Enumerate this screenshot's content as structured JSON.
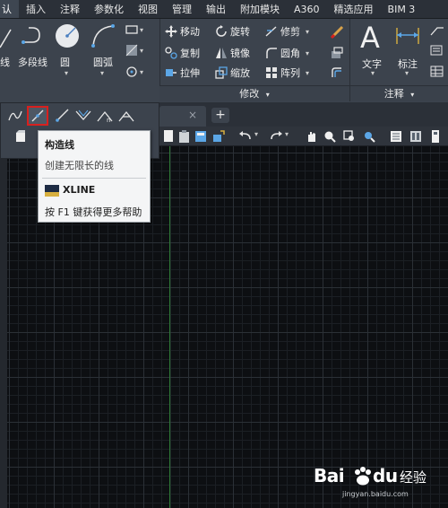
{
  "ribbon_tabs": [
    "认",
    "插入",
    "注释",
    "参数化",
    "视图",
    "管理",
    "输出",
    "附加模块",
    "A360",
    "精选应用",
    "BIM 3"
  ],
  "active_tab_index": 0,
  "draw_panel": {
    "line_label": "线",
    "polyline_label": "多段线",
    "circle_label": "圆",
    "arc_label": "圆弧"
  },
  "modify_panel": {
    "move": "移动",
    "rotate": "旋转",
    "trim": "修剪",
    "copy": "复制",
    "mirror": "镜像",
    "fillet": "圆角",
    "stretch": "拉伸",
    "scale": "缩放",
    "array": "阵列",
    "footer": "修改"
  },
  "annotation_panel": {
    "text": "文字",
    "dimension": "标注",
    "footer": "注释"
  },
  "tooltip": {
    "title": "构造线",
    "description": "创建无限长的线",
    "command": "XLINE",
    "help": "按 F1 键获得更多帮助"
  },
  "file_tab": {
    "close_glyph": "×",
    "new_tab_glyph": "+"
  },
  "watermark": {
    "brand": "Bai",
    "brand_suffix": "du",
    "chinese": "经验",
    "url": "jingyan.baidu.com"
  },
  "colors": {
    "accent_red": "#d8201e",
    "axis_green": "#2f7a36",
    "ribbon_bg": "#3c434d"
  }
}
